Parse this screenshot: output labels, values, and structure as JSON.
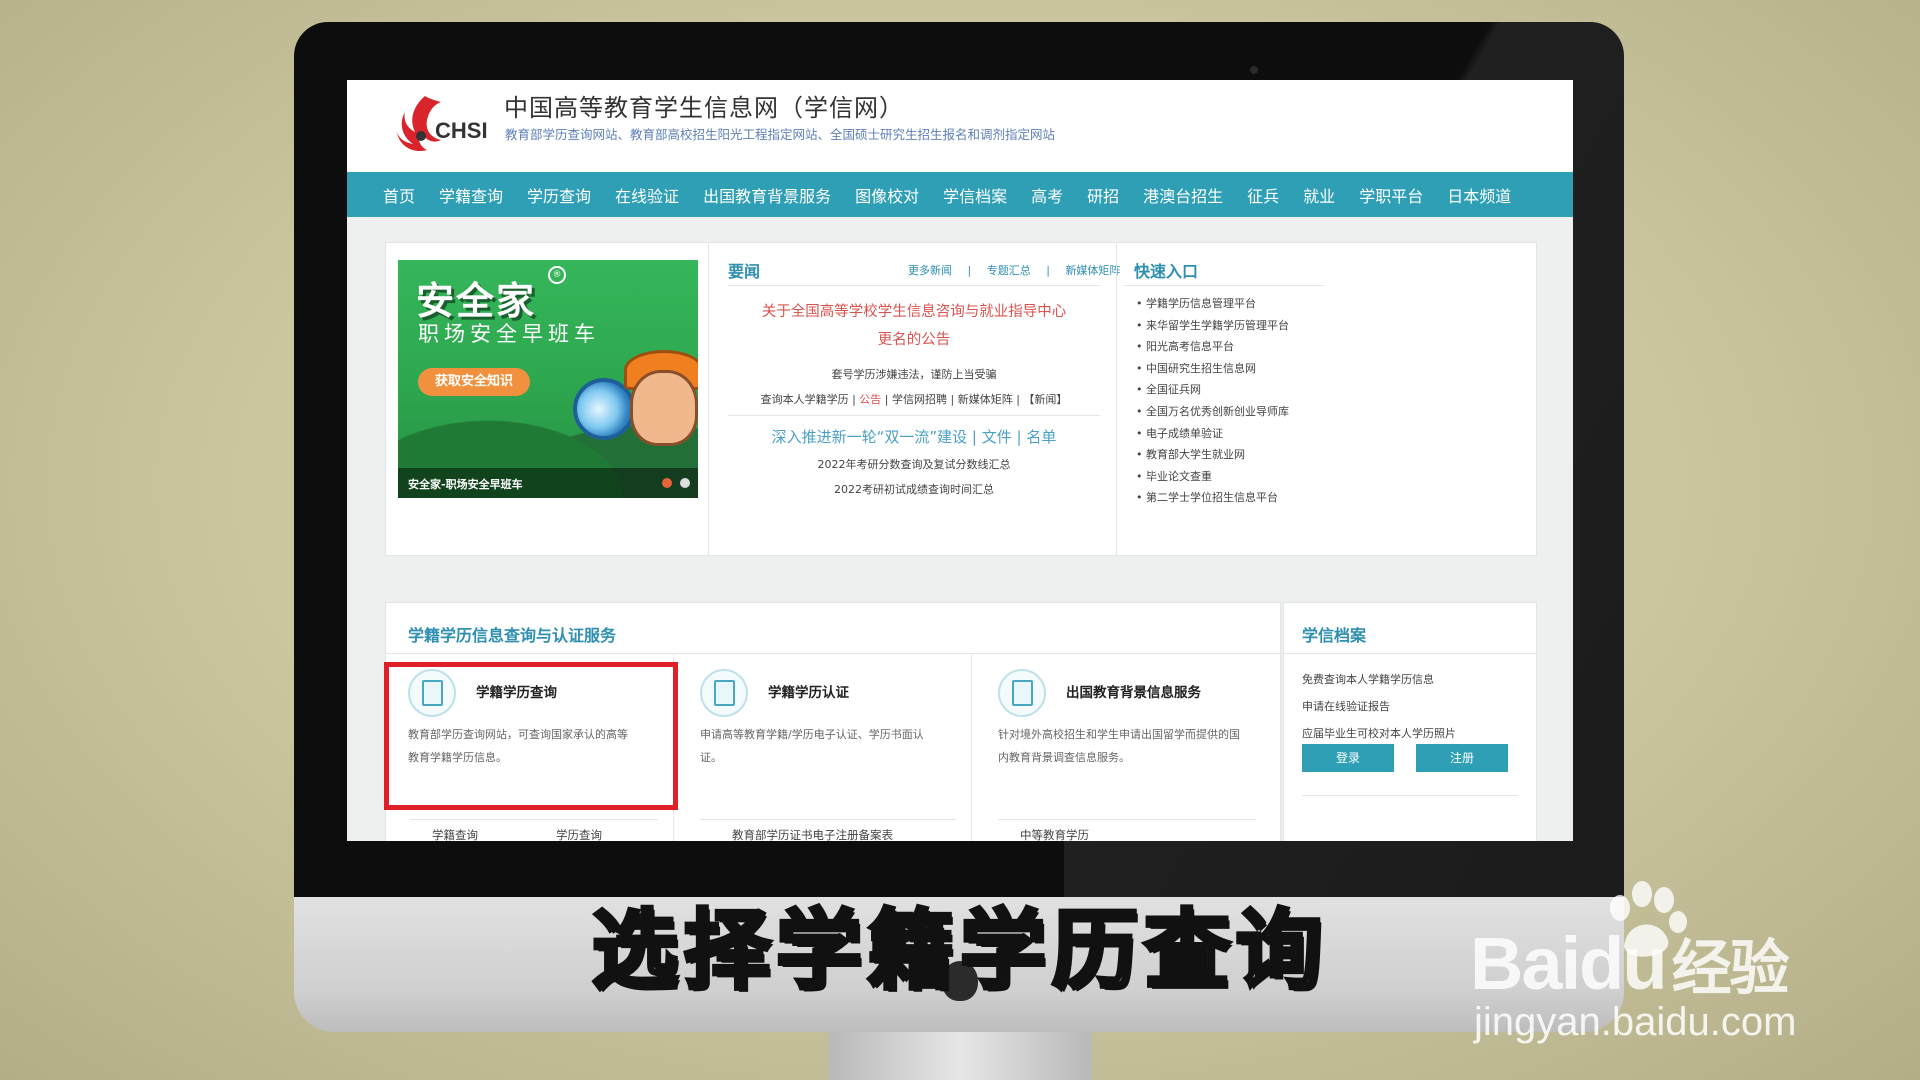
{
  "site": {
    "logo_text": "CHSI",
    "title": "中国高等教育学生信息网（学信网）",
    "subtitle": "教育部学历查询网站、教育部高校招生阳光工程指定网站、全国硕士研究生招生报名和调剂指定网站"
  },
  "nav": [
    "首页",
    "学籍查询",
    "学历查询",
    "在线验证",
    "出国教育背景服务",
    "图像校对",
    "学信档案",
    "高考",
    "研招",
    "港澳台招生",
    "征兵",
    "就业",
    "学职平台",
    "日本频道"
  ],
  "banner": {
    "title": "安全家",
    "subtitle": "职场安全早班车",
    "button": "获取安全知识",
    "caption": "安全家-职场安全早班车"
  },
  "news": {
    "heading": "要闻",
    "links": [
      "更多新闻",
      "|",
      "专题汇总",
      "|",
      "新媒体矩阵"
    ],
    "main_line1": "关于全国高等学校学生信息咨询与就业指导中心",
    "main_line2": "更名的公告",
    "line_warning": "套号学历涉嫌违法，谨防上当受骗",
    "line_links_a": "查询本人学籍学历 |",
    "line_links_red": "公告",
    "line_links_b": "| 学信网招聘 | 新媒体矩阵 | 【新闻】",
    "feature": "深入推进新一轮“双一流”建设 | 文件 | 名单",
    "line_kaoyan": "2022年考研分数查询及复试分数线汇总",
    "line_chengji": "2022考研初试成绩查询时间汇总"
  },
  "quick": {
    "heading": "快速入口",
    "items": [
      "• 学籍学历信息管理平台",
      "• 来华留学生学籍学历管理平台",
      "• 阳光高考信息平台",
      "• 中国研究生招生信息网",
      "• 全国征兵网",
      "• 全国万名优秀创新创业导师库",
      "• 电子成绩单验证",
      "• 教育部大学生就业网",
      "• 毕业论文查重",
      "• 第二学士学位招生信息平台"
    ]
  },
  "services": {
    "heading": "学籍学历信息查询与认证服务",
    "items": [
      {
        "title": "学籍学历查询",
        "desc": "教育部学历查询网站，可查询国家承认的高等教育学籍学历信息。"
      },
      {
        "title": "学籍学历认证",
        "desc": "申请高等教育学籍/学历电子认证、学历书面认证。"
      },
      {
        "title": "出国教育背景信息服务",
        "desc": "针对境外高校招生和学生申请出国留学而提供的国内教育背景调查信息服务。"
      }
    ],
    "foot_a1": "学籍查询",
    "foot_a2": "学历查询",
    "foot_b": "教育部学历证书电子注册备案表",
    "foot_c": "中等教育学历"
  },
  "archive": {
    "heading": "学信档案",
    "lines": [
      "免费查询本人学籍学历信息",
      "申请在线验证报告",
      "应届毕业生可校对本人学历照片"
    ],
    "login": "登录",
    "register": "注册"
  },
  "caption": "选择学籍学历查询",
  "watermark": {
    "main": "Bai",
    "du": "du",
    "suffix": "经验",
    "url": "jingyan.baidu.com"
  },
  "colors": {
    "nav": "#2f9fb5",
    "link": "#2e8fb0",
    "news_red": "#d9534f",
    "highlight": "#e01f2a"
  }
}
